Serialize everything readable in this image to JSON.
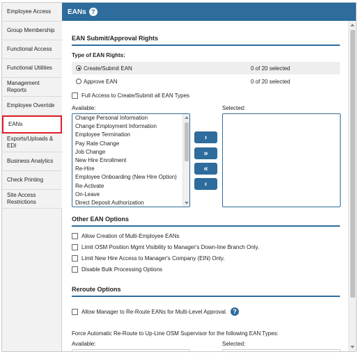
{
  "sidebar": {
    "items": [
      {
        "label": "Employee Access"
      },
      {
        "label": "Group Membership"
      },
      {
        "label": "Functional Access"
      },
      {
        "label": "Functional Utilities"
      },
      {
        "label": "Management Reports"
      },
      {
        "label": "Employee Override"
      },
      {
        "label": "EANs"
      },
      {
        "label": "Exports/Uploads & EDI"
      },
      {
        "label": "Business Analytics"
      },
      {
        "label": "Check Printing"
      },
      {
        "label": "Site Access Restrictions"
      }
    ],
    "active": "EANs"
  },
  "header": {
    "title": "EANs",
    "help_glyph": "?"
  },
  "submit_section": {
    "title": "EAN Submit/Approval Rights",
    "type_label": "Type of EAN Rights:",
    "options": [
      {
        "label": "Create/Submit EAN",
        "count": "0 of 20 selected",
        "selected": true
      },
      {
        "label": "Approve EAN",
        "count": "0 of 20 selected",
        "selected": false
      }
    ],
    "full_access_label": "Full Access to Create/Submit all EAN Types",
    "available_label": "Available:",
    "selected_label": "Selected:",
    "available_items": [
      "Change Personal Information",
      "Change Employment Information",
      "Employee Termination",
      "Pay Rate Change",
      "Job Change",
      "New Hire Enrollment",
      "Re-Hire",
      "Employee Onboarding (New Hire Option)",
      "Re-Activate",
      "On-Leave",
      "Direct Deposit Authorization"
    ],
    "buttons": {
      "move_one_right": "›",
      "move_all_right": "»",
      "move_all_left": "«",
      "move_one_left": "‹"
    }
  },
  "other_section": {
    "title": "Other EAN Options",
    "options": [
      "Allow Creation of Multi-Employee EANs",
      "Limit OSM Position Mgmt Visibility to Manager's Down-line Branch Only.",
      "Limit New Hire Access to Manager's Company (EIN) Only.",
      "Disable Bulk Processing Options"
    ]
  },
  "reroute_section": {
    "title": "Reroute Options",
    "allow_label": "Allow Manager to Re-Route EANs for Multi-Level Approval.",
    "help_glyph": "?",
    "force_label": "Force Automatic Re-Route to Up-Line OSM Supervisor for the following EAN Types:",
    "available_label": "Available:",
    "selected_label": "Selected:"
  },
  "colors": {
    "brand": "#2d6c9c",
    "active_outline": "#e0202a"
  }
}
